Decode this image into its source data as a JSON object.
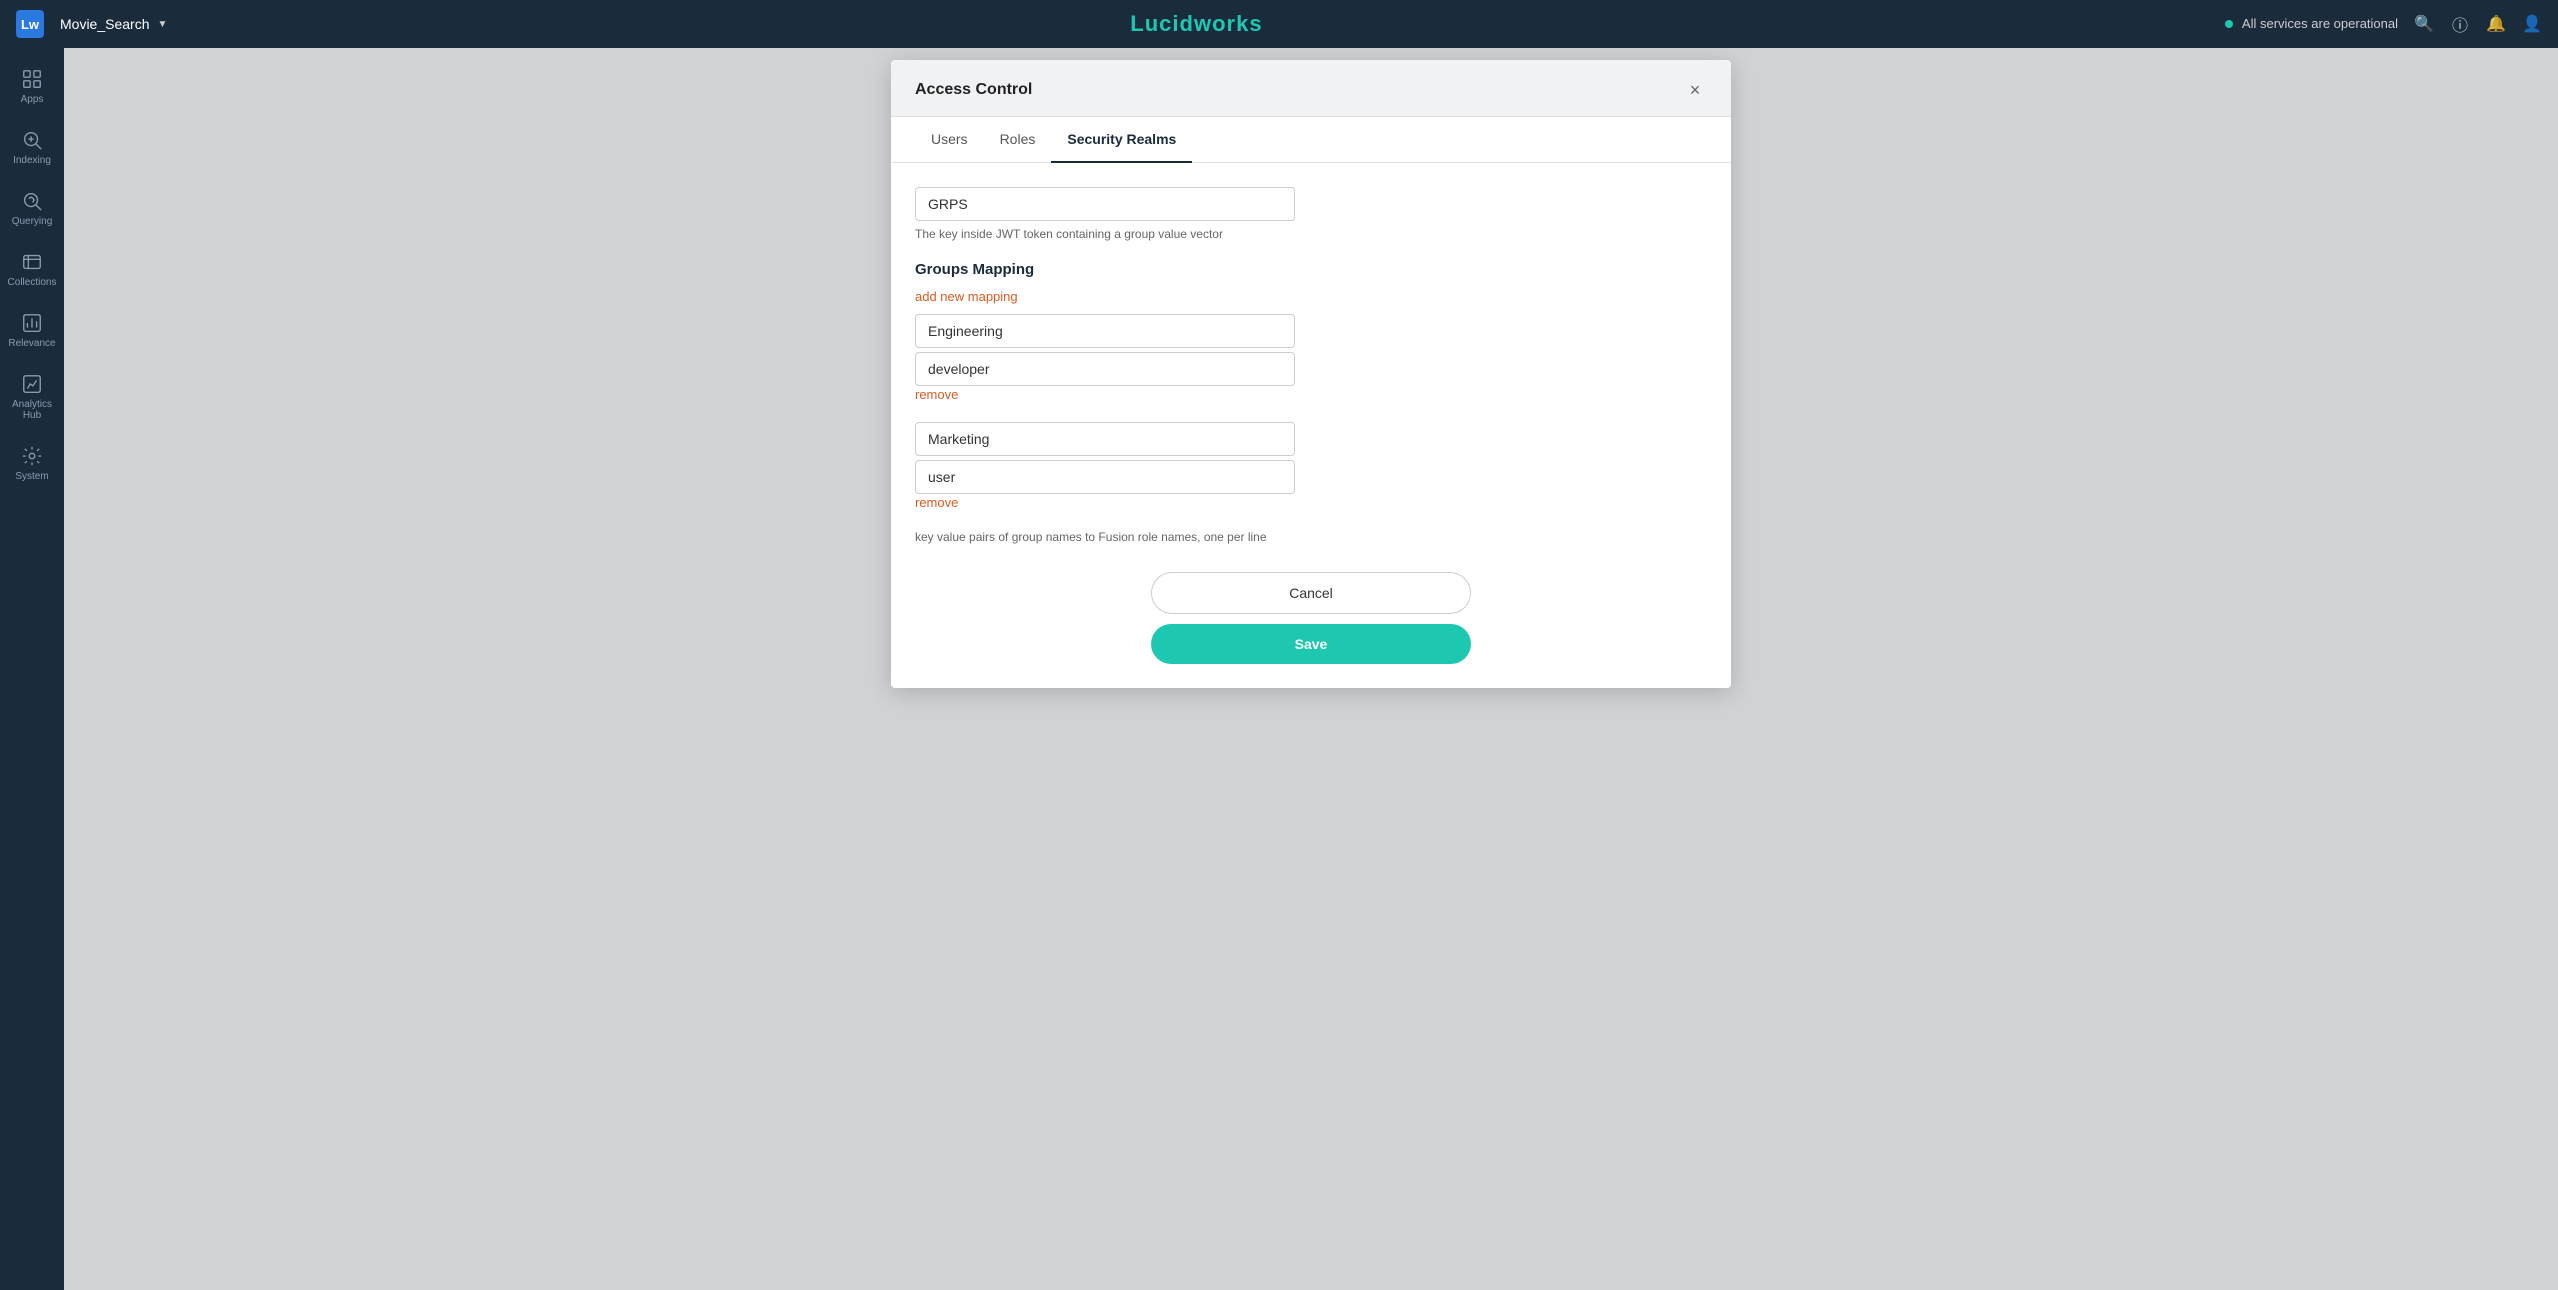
{
  "topnav": {
    "logo": "Lw",
    "app_name": "Movie_Search",
    "brand_lucid": "Lucid",
    "brand_works": "works",
    "status_text": "All services are operational"
  },
  "sidebar": {
    "items": [
      {
        "id": "apps",
        "label": "Apps",
        "icon": "grid"
      },
      {
        "id": "indexing",
        "label": "Indexing",
        "icon": "indexing"
      },
      {
        "id": "querying",
        "label": "Querying",
        "icon": "querying"
      },
      {
        "id": "collections",
        "label": "Collections",
        "icon": "collections"
      },
      {
        "id": "relevance",
        "label": "Relevance",
        "icon": "relevance"
      },
      {
        "id": "analytics-hub",
        "label": "Analytics Hub",
        "icon": "analytics"
      },
      {
        "id": "system",
        "label": "System",
        "icon": "system"
      }
    ]
  },
  "modal": {
    "title": "Access Control",
    "tabs": [
      {
        "id": "users",
        "label": "Users",
        "active": false
      },
      {
        "id": "roles",
        "label": "Roles",
        "active": false
      },
      {
        "id": "security-realms",
        "label": "Security Realms",
        "active": true
      }
    ],
    "grps_field": {
      "value": "GRPS",
      "description": "The key inside JWT token containing a group value vector"
    },
    "groups_mapping": {
      "title": "Groups Mapping",
      "add_link": "add new mapping",
      "pairs": [
        {
          "key": "Engineering",
          "value": "developer"
        },
        {
          "key": "Marketing",
          "value": "user"
        }
      ],
      "remove_label": "remove",
      "footer_desc": "key value pairs of group names to Fusion role names, one per line"
    },
    "buttons": {
      "cancel": "Cancel",
      "save": "Save"
    }
  }
}
